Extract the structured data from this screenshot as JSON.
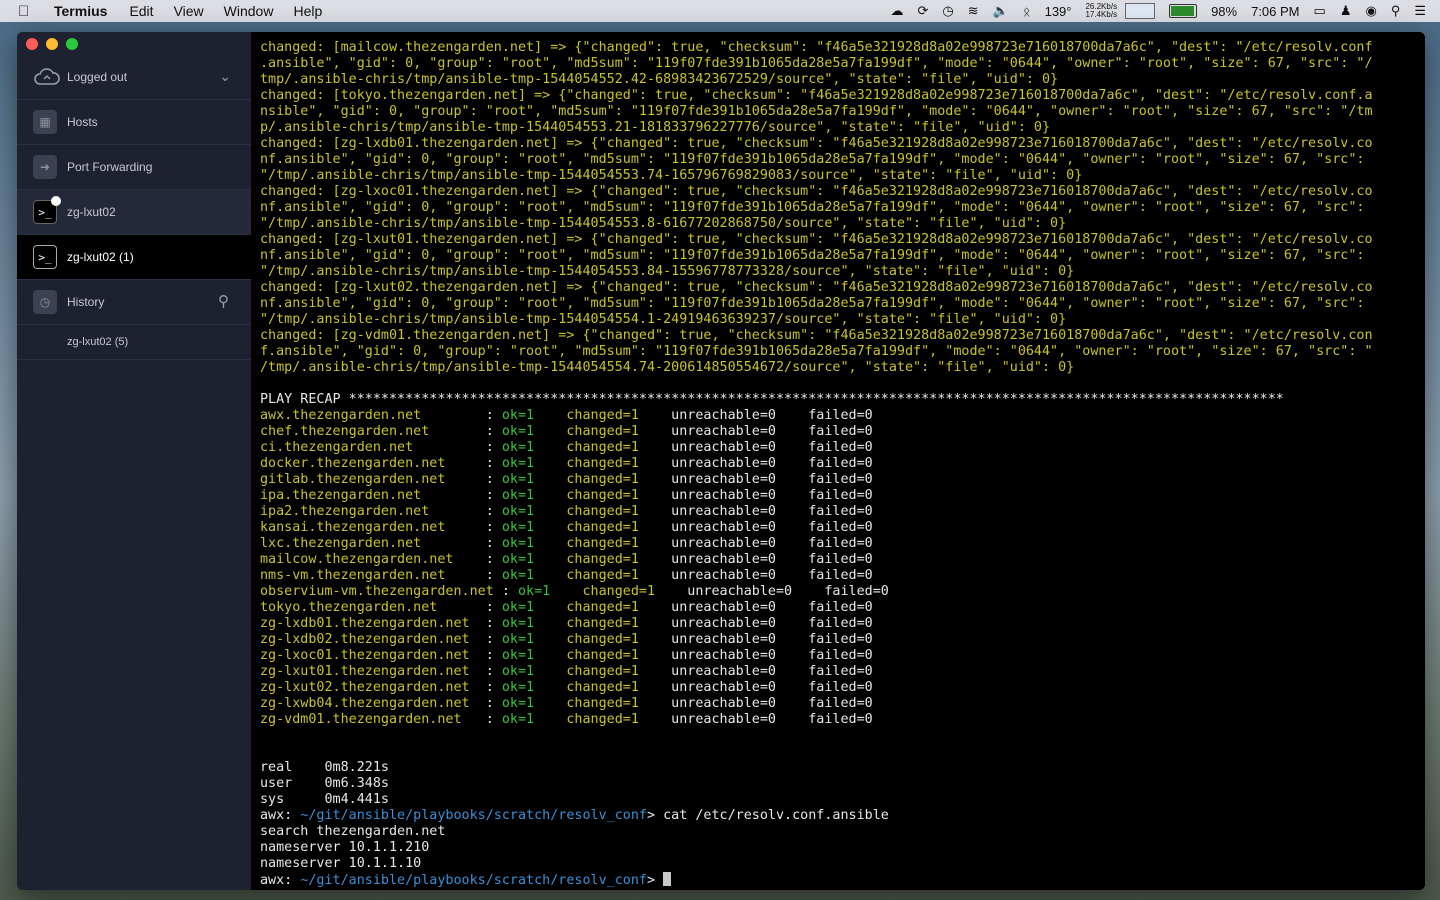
{
  "menubar": {
    "app": "Termius",
    "items": [
      "Edit",
      "View",
      "Window",
      "Help"
    ],
    "net_up": "26.2Kb/s",
    "net_down": "17.4Kb/s",
    "temp": "139°",
    "battery": "98%",
    "time": "7:06 PM"
  },
  "sidebar": {
    "account": "Logged out",
    "hosts": "Hosts",
    "port_forwarding": "Port Forwarding",
    "session1": "zg-lxut02",
    "session2": "zg-lxut02 (1)",
    "history": "History",
    "history_item": "zg-lxut02 (5)"
  },
  "terminal": {
    "changed_lines": [
      "changed: [mailcow.thezengarden.net] => {\"changed\": true, \"checksum\": \"f46a5e321928d8a02e998723e716018700da7a6c\", \"dest\": \"/etc/resolv.conf",
      ".ansible\", \"gid\": 0, \"group\": \"root\", \"md5sum\": \"119f07fde391b1065da28e5a7fa199df\", \"mode\": \"0644\", \"owner\": \"root\", \"size\": 67, \"src\": \"/",
      "tmp/.ansible-chris/tmp/ansible-tmp-1544054552.42-68983423672529/source\", \"state\": \"file\", \"uid\": 0}",
      "changed: [tokyo.thezengarden.net] => {\"changed\": true, \"checksum\": \"f46a5e321928d8a02e998723e716018700da7a6c\", \"dest\": \"/etc/resolv.conf.a",
      "nsible\", \"gid\": 0, \"group\": \"root\", \"md5sum\": \"119f07fde391b1065da28e5a7fa199df\", \"mode\": \"0644\", \"owner\": \"root\", \"size\": 67, \"src\": \"/tm",
      "p/.ansible-chris/tmp/ansible-tmp-1544054553.21-181833796227776/source\", \"state\": \"file\", \"uid\": 0}",
      "changed: [zg-lxdb01.thezengarden.net] => {\"changed\": true, \"checksum\": \"f46a5e321928d8a02e998723e716018700da7a6c\", \"dest\": \"/etc/resolv.co",
      "nf.ansible\", \"gid\": 0, \"group\": \"root\", \"md5sum\": \"119f07fde391b1065da28e5a7fa199df\", \"mode\": \"0644\", \"owner\": \"root\", \"size\": 67, \"src\":",
      "\"/tmp/.ansible-chris/tmp/ansible-tmp-1544054553.74-165796769829083/source\", \"state\": \"file\", \"uid\": 0}",
      "changed: [zg-lxoc01.thezengarden.net] => {\"changed\": true, \"checksum\": \"f46a5e321928d8a02e998723e716018700da7a6c\", \"dest\": \"/etc/resolv.co",
      "nf.ansible\", \"gid\": 0, \"group\": \"root\", \"md5sum\": \"119f07fde391b1065da28e5a7fa199df\", \"mode\": \"0644\", \"owner\": \"root\", \"size\": 67, \"src\":",
      "\"/tmp/.ansible-chris/tmp/ansible-tmp-1544054553.8-61677202868750/source\", \"state\": \"file\", \"uid\": 0}",
      "changed: [zg-lxut01.thezengarden.net] => {\"changed\": true, \"checksum\": \"f46a5e321928d8a02e998723e716018700da7a6c\", \"dest\": \"/etc/resolv.co",
      "nf.ansible\", \"gid\": 0, \"group\": \"root\", \"md5sum\": \"119f07fde391b1065da28e5a7fa199df\", \"mode\": \"0644\", \"owner\": \"root\", \"size\": 67, \"src\":",
      "\"/tmp/.ansible-chris/tmp/ansible-tmp-1544054553.84-15596778773328/source\", \"state\": \"file\", \"uid\": 0}",
      "changed: [zg-lxut02.thezengarden.net] => {\"changed\": true, \"checksum\": \"f46a5e321928d8a02e998723e716018700da7a6c\", \"dest\": \"/etc/resolv.co",
      "nf.ansible\", \"gid\": 0, \"group\": \"root\", \"md5sum\": \"119f07fde391b1065da28e5a7fa199df\", \"mode\": \"0644\", \"owner\": \"root\", \"size\": 67, \"src\":",
      "\"/tmp/.ansible-chris/tmp/ansible-tmp-1544054554.1-24919463639237/source\", \"state\": \"file\", \"uid\": 0}",
      "changed: [zg-vdm01.thezengarden.net] => {\"changed\": true, \"checksum\": \"f46a5e321928d8a02e998723e716018700da7a6c\", \"dest\": \"/etc/resolv.con",
      "f.ansible\", \"gid\": 0, \"group\": \"root\", \"md5sum\": \"119f07fde391b1065da28e5a7fa199df\", \"mode\": \"0644\", \"owner\": \"root\", \"size\": 67, \"src\": \"",
      "/tmp/.ansible-chris/tmp/ansible-tmp-1544054554.74-200614850554672/source\", \"state\": \"file\", \"uid\": 0}"
    ],
    "play_recap": "PLAY RECAP ********************************************************************************************************************",
    "recap": [
      {
        "host": "awx.thezengarden.net       ",
        "ok": "ok=1",
        "changed": "changed=1",
        "unreachable": "unreachable=0",
        "failed": "failed=0"
      },
      {
        "host": "chef.thezengarden.net      ",
        "ok": "ok=1",
        "changed": "changed=1",
        "unreachable": "unreachable=0",
        "failed": "failed=0"
      },
      {
        "host": "ci.thezengarden.net        ",
        "ok": "ok=1",
        "changed": "changed=1",
        "unreachable": "unreachable=0",
        "failed": "failed=0"
      },
      {
        "host": "docker.thezengarden.net    ",
        "ok": "ok=1",
        "changed": "changed=1",
        "unreachable": "unreachable=0",
        "failed": "failed=0"
      },
      {
        "host": "gitlab.thezengarden.net    ",
        "ok": "ok=1",
        "changed": "changed=1",
        "unreachable": "unreachable=0",
        "failed": "failed=0"
      },
      {
        "host": "ipa.thezengarden.net       ",
        "ok": "ok=1",
        "changed": "changed=1",
        "unreachable": "unreachable=0",
        "failed": "failed=0"
      },
      {
        "host": "ipa2.thezengarden.net      ",
        "ok": "ok=1",
        "changed": "changed=1",
        "unreachable": "unreachable=0",
        "failed": "failed=0"
      },
      {
        "host": "kansai.thezengarden.net    ",
        "ok": "ok=1",
        "changed": "changed=1",
        "unreachable": "unreachable=0",
        "failed": "failed=0"
      },
      {
        "host": "lxc.thezengarden.net       ",
        "ok": "ok=1",
        "changed": "changed=1",
        "unreachable": "unreachable=0",
        "failed": "failed=0"
      },
      {
        "host": "mailcow.thezengarden.net   ",
        "ok": "ok=1",
        "changed": "changed=1",
        "unreachable": "unreachable=0",
        "failed": "failed=0"
      },
      {
        "host": "nms-vm.thezengarden.net    ",
        "ok": "ok=1",
        "changed": "changed=1",
        "unreachable": "unreachable=0",
        "failed": "failed=0"
      },
      {
        "host": "observium-vm.thezengarden.net",
        "ok": "ok=1",
        "changed": "changed=1",
        "unreachable": "unreachable=0",
        "failed": "failed=0"
      },
      {
        "host": "tokyo.thezengarden.net     ",
        "ok": "ok=1",
        "changed": "changed=1",
        "unreachable": "unreachable=0",
        "failed": "failed=0"
      },
      {
        "host": "zg-lxdb01.thezengarden.net ",
        "ok": "ok=1",
        "changed": "changed=1",
        "unreachable": "unreachable=0",
        "failed": "failed=0"
      },
      {
        "host": "zg-lxdb02.thezengarden.net ",
        "ok": "ok=1",
        "changed": "changed=1",
        "unreachable": "unreachable=0",
        "failed": "failed=0"
      },
      {
        "host": "zg-lxoc01.thezengarden.net ",
        "ok": "ok=1",
        "changed": "changed=1",
        "unreachable": "unreachable=0",
        "failed": "failed=0"
      },
      {
        "host": "zg-lxut01.thezengarden.net ",
        "ok": "ok=1",
        "changed": "changed=1",
        "unreachable": "unreachable=0",
        "failed": "failed=0"
      },
      {
        "host": "zg-lxut02.thezengarden.net ",
        "ok": "ok=1",
        "changed": "changed=1",
        "unreachable": "unreachable=0",
        "failed": "failed=0"
      },
      {
        "host": "zg-lxwb04.thezengarden.net ",
        "ok": "ok=1",
        "changed": "changed=1",
        "unreachable": "unreachable=0",
        "failed": "failed=0"
      },
      {
        "host": "zg-vdm01.thezengarden.net  ",
        "ok": "ok=1",
        "changed": "changed=1",
        "unreachable": "unreachable=0",
        "failed": "failed=0"
      }
    ],
    "timing": [
      "real    0m8.221s",
      "user    0m6.348s",
      "sys     0m4.441s"
    ],
    "prompt_host": "awx: ",
    "prompt_path": "~/git/ansible/playbooks/scratch/resolv_conf",
    "prompt_suffix": "> ",
    "command": "cat /etc/resolv.conf.ansible",
    "output": [
      "search thezengarden.net",
      "nameserver 10.1.1.210",
      "nameserver 10.1.1.10"
    ]
  }
}
